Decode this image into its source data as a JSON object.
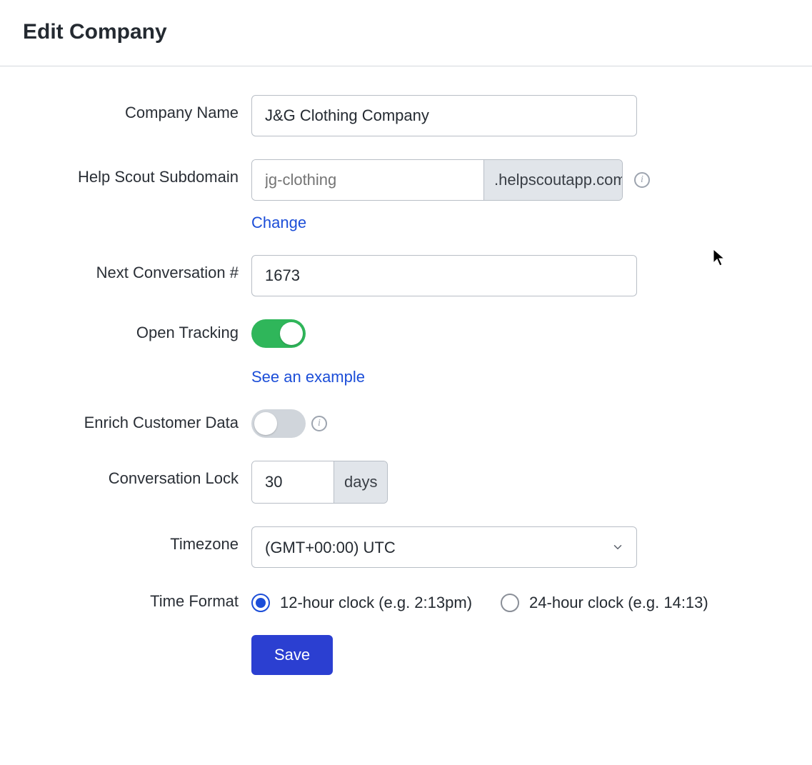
{
  "header": {
    "title": "Edit Company"
  },
  "labels": {
    "company_name": "Company Name",
    "subdomain": "Help Scout Subdomain",
    "next_conv": "Next Conversation #",
    "open_tracking": "Open Tracking",
    "enrich": "Enrich Customer Data",
    "conversation_lock": "Conversation Lock",
    "timezone": "Timezone",
    "time_format": "Time Format"
  },
  "fields": {
    "company_name": "J&G Clothing Company",
    "subdomain_placeholder": "jg-clothing",
    "subdomain_suffix": ".helpscoutapp.com",
    "change_link": "Change",
    "next_conv": "1673",
    "open_tracking_on": true,
    "see_example_link": "See an example",
    "enrich_on": false,
    "lock_value": "30",
    "lock_suffix": "days",
    "timezone_selected": "(GMT+00:00) UTC",
    "time_format_selected": "12",
    "tf_12_label": "12-hour clock (e.g. 2:13pm)",
    "tf_24_label": "24-hour clock (e.g. 14:13)"
  },
  "buttons": {
    "save": "Save"
  },
  "icons": {
    "info_glyph": "i"
  }
}
